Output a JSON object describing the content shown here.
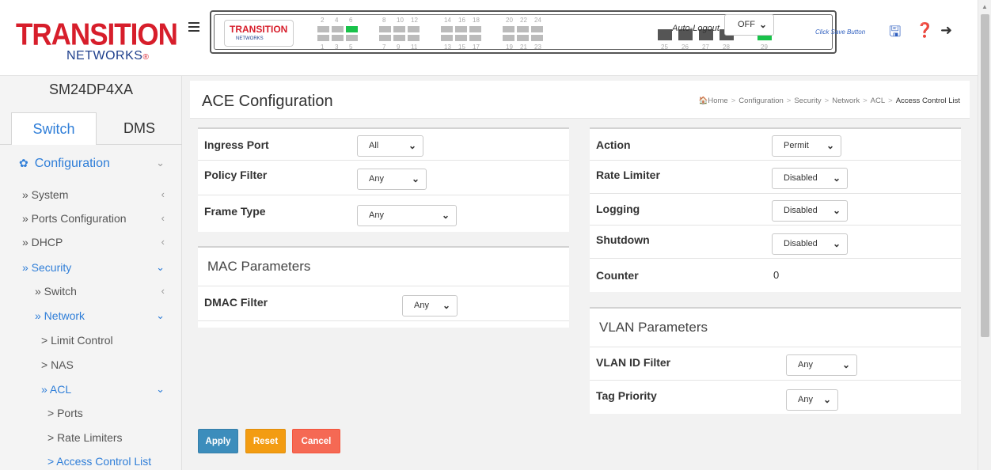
{
  "brand": {
    "logo_main": "TRANSITION",
    "logo_sub": "NETWORKS",
    "model": "SM24DP4XA"
  },
  "tabs": {
    "switch": "Switch",
    "dms": "DMS"
  },
  "menu": {
    "configuration": "Configuration",
    "system": "» System",
    "ports_configuration": "» Ports Configuration",
    "dhcp": "» DHCP",
    "security": "» Security",
    "switch": "» Switch",
    "network": "» Network",
    "limit_control": "> Limit Control",
    "nas": "> NAS",
    "acl": "» ACL",
    "ports": "> Ports",
    "rate_limiters": "> Rate Limiters",
    "access_control_list": "> Access Control List"
  },
  "header": {
    "auto_logout_label": "Auto-Logout",
    "auto_logout_value": "OFF",
    "save_hint": "Click Save Button",
    "port_numbers_top": [
      "2",
      "4",
      "6",
      "8",
      "10",
      "12",
      "14",
      "16",
      "18",
      "20",
      "22",
      "24"
    ],
    "port_numbers_bottom": [
      "1",
      "3",
      "5",
      "7",
      "9",
      "11",
      "13",
      "15",
      "17",
      "19",
      "21",
      "23"
    ],
    "sfp_numbers": [
      "25",
      "26",
      "27",
      "28",
      "29"
    ]
  },
  "page": {
    "title": "ACE Configuration",
    "breadcrumb": [
      "Home",
      "Configuration",
      "Security",
      "Network",
      "ACL",
      "Access Control List"
    ]
  },
  "left_panel": {
    "ingress_port": {
      "label": "Ingress Port",
      "value": "All"
    },
    "policy_filter": {
      "label": "Policy Filter",
      "value": "Any"
    },
    "frame_type": {
      "label": "Frame Type",
      "value": "Any"
    }
  },
  "mac_parameters": {
    "title": "MAC Parameters",
    "dmac_filter": {
      "label": "DMAC Filter",
      "value": "Any"
    }
  },
  "right_panel": {
    "action": {
      "label": "Action",
      "value": "Permit"
    },
    "rate_limiter": {
      "label": "Rate Limiter",
      "value": "Disabled"
    },
    "logging": {
      "label": "Logging",
      "value": "Disabled"
    },
    "shutdown": {
      "label": "Shutdown",
      "value": "Disabled"
    },
    "counter": {
      "label": "Counter",
      "value": "0"
    }
  },
  "vlan_parameters": {
    "title": "VLAN Parameters",
    "vlan_id_filter": {
      "label": "VLAN ID Filter",
      "value": "Any"
    },
    "tag_priority": {
      "label": "Tag Priority",
      "value": "Any"
    }
  },
  "buttons": {
    "apply": "Apply",
    "reset": "Reset",
    "cancel": "Cancel"
  }
}
